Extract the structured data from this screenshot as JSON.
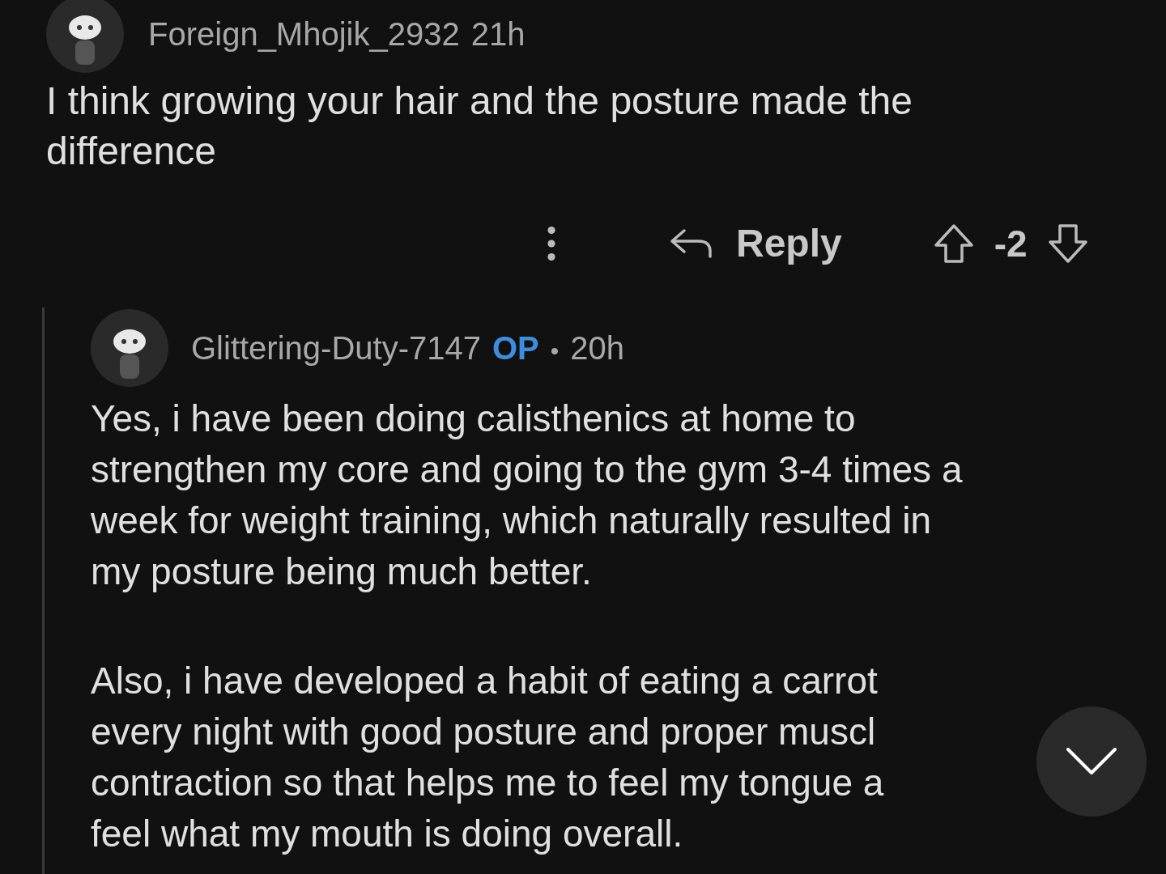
{
  "comment": {
    "author": "Foreign_Mhojik_2932",
    "time": "21h",
    "body_lines": [
      "I think growing your hair and the posture made the",
      "difference"
    ],
    "reply_label": "Reply",
    "score": "-2"
  },
  "reply": {
    "author": "Glittering-Duty-7147",
    "badge": "OP",
    "separator": "•",
    "time": "20h",
    "paragraphs": [
      [
        "Yes, i have been doing calisthenics at home to",
        "strengthen my core and going to the gym 3-4 times a",
        "week for weight training, which naturally resulted in",
        "my posture being much better."
      ],
      [
        "Also, i have developed a habit of eating a carrot",
        "every night with good posture and proper muscl",
        "contraction so that helps me to feel my tongue a",
        "feel what my mouth is doing overall."
      ]
    ]
  }
}
